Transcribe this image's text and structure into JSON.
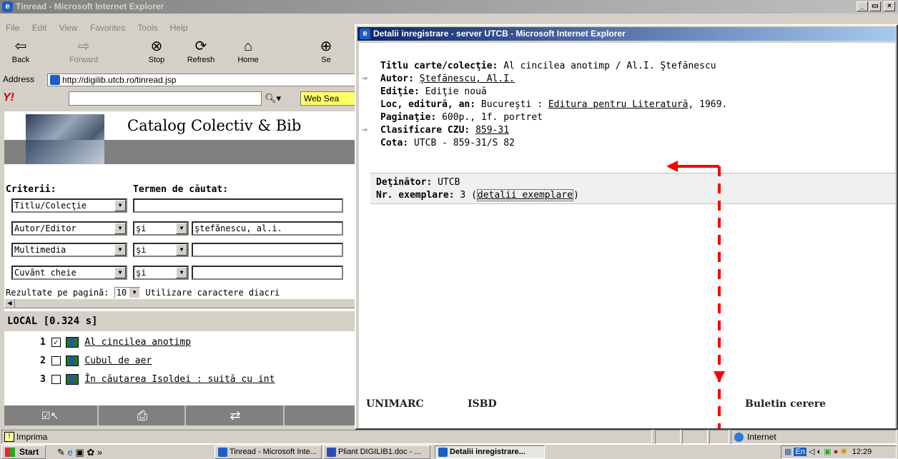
{
  "main_window": {
    "title": "Tinread - Microsoft Internet Explorer",
    "menu": [
      "File",
      "Edit",
      "View",
      "Favorites",
      "Tools",
      "Help"
    ],
    "toolbar": {
      "back": "Back",
      "forward": "Forward",
      "stop": "Stop",
      "refresh": "Refresh",
      "home": "Home",
      "search": "Se"
    },
    "address_label": "Address",
    "address_value": "http://digilib.utcb.ro/tinread.jsp",
    "yahoo_search_label": "Web Sea",
    "banner_title": "Catalog Colectiv & Bib",
    "criteria_label": "Criterii:",
    "term_label": "Termen de căutat:",
    "rows": [
      {
        "field": "Titlu/Colecţie",
        "op": "",
        "value": ""
      },
      {
        "field": "Autor/Editor",
        "op": "şi",
        "value": "ştefănescu, al.i."
      },
      {
        "field": "Multimedia",
        "op": "şi",
        "value": ""
      },
      {
        "field": "Cuvânt cheie",
        "op": "şi",
        "value": ""
      }
    ],
    "results_per_page_label": "Rezultate pe pagină:",
    "results_per_page_value": "10",
    "diacritics_label": "Utilizare caractere diacri",
    "local_header": "LOCAL [0.324 s]",
    "results": [
      {
        "num": "1",
        "checked": true,
        "title": "Al cincilea anotimp"
      },
      {
        "num": "2",
        "checked": false,
        "title": "Cubul de aer"
      },
      {
        "num": "3",
        "checked": false,
        "title": "În căutarea Isoldei : suită cu int"
      }
    ],
    "status_text": "Imprima",
    "status_zone": "Internet"
  },
  "popup_window": {
    "title": "Detalii inregistrare - server UTCB - Microsoft Internet Explorer",
    "record": {
      "title_label": "Titlu carte/colecţie:",
      "title_value": "Al cincilea anotimp / Al.I. Ştefănescu",
      "author_label": "Autor:",
      "author_value": "Ştefănescu, Al.I.",
      "edition_label": "Ediţie:",
      "edition_value": "Ediţie nouă",
      "place_label": "Loc, editură, an:",
      "place_value": "Bucureşti :",
      "publisher_value": "Editura pentru Literatură",
      "year_value": ", 1969.",
      "pages_label": "Paginaţie:",
      "pages_value": "600p., 1f. portret",
      "czu_label": "Clasificare CZU:",
      "czu_value": "859-31",
      "cota_label": "Cota:",
      "cota_value": "UTCB - 859-31/S 82"
    },
    "holder_label": "Deţinător:",
    "holder_value": "UTCB",
    "copies_label": "Nr. exemplare:",
    "copies_value": "3",
    "copies_link_open": "(",
    "copies_link": "detalii exemplare",
    "copies_link_close": ")",
    "footer_links": [
      "UNIMARC",
      "ISBD",
      "Buletin cerere"
    ]
  },
  "taskbar": {
    "start": "Start",
    "tasks": [
      "Tinread - Microsoft Inte...",
      "Pliant DIGILIB1.doc - ...",
      "Detalii inregistrare..."
    ],
    "tray_lang": "En",
    "clock": "12:29"
  },
  "annotation_color": "#ff0000"
}
